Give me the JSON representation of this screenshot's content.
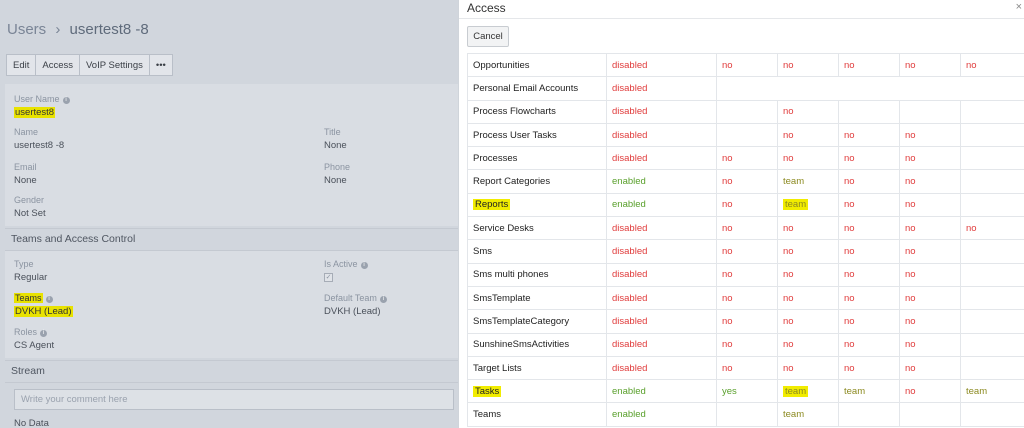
{
  "page": {
    "breadcrumb_root": "Users",
    "breadcrumb_sep": "›",
    "breadcrumb_user": "usertest8 -8"
  },
  "toolbar": {
    "edit_label": "Edit",
    "access_label": "Access",
    "voip_label": "VoIP Settings",
    "more_label": "•••"
  },
  "fields": {
    "user_name_label": "User Name",
    "user_name_value": "usertest8",
    "name_label": "Name",
    "name_value": "usertest8 -8",
    "title_label": "Title",
    "title_value": "None",
    "email_label": "Email",
    "email_value": "None",
    "phone_label": "Phone",
    "phone_value": "None",
    "gender_label": "Gender",
    "gender_value": "Not Set"
  },
  "teams_section": {
    "title": "Teams and Access Control",
    "type_label": "Type",
    "type_value": "Regular",
    "is_active_label": "Is Active",
    "is_active_checked": true,
    "teams_label": "Teams",
    "teams_value": "DVKH (Lead)",
    "default_team_label": "Default Team",
    "default_team_value": "DVKH (Lead)",
    "roles_label": "Roles",
    "roles_value": "CS Agent"
  },
  "stream": {
    "title": "Stream",
    "comment_placeholder": "Write your comment here",
    "empty_text": "No Data"
  },
  "modal": {
    "title": "Access",
    "close_glyph": "×",
    "cancel_label": "Cancel",
    "rows": [
      {
        "name": "Opportunities",
        "status": "disabled",
        "cells": [
          "no",
          "no",
          "no",
          "no",
          "no"
        ]
      },
      {
        "name": "Personal Email Accounts",
        "status": "disabled",
        "cells": []
      },
      {
        "name": "Process Flowcharts",
        "status": "disabled",
        "cells": [
          "",
          "no",
          "",
          "",
          ""
        ]
      },
      {
        "name": "Process User Tasks",
        "status": "disabled",
        "cells": [
          "",
          "no",
          "no",
          "no",
          ""
        ]
      },
      {
        "name": "Processes",
        "status": "disabled",
        "cells": [
          "no",
          "no",
          "no",
          "no",
          ""
        ]
      },
      {
        "name": "Report Categories",
        "status": "enabled",
        "cells": [
          "no",
          "team",
          "no",
          "no",
          ""
        ]
      },
      {
        "name": "Reports",
        "status": "enabled",
        "cells": [
          "no",
          "team",
          "no",
          "no",
          ""
        ],
        "highlight_name": true,
        "highlight_cell": 1
      },
      {
        "name": "Service Desks",
        "status": "disabled",
        "cells": [
          "no",
          "no",
          "no",
          "no",
          "no"
        ]
      },
      {
        "name": "Sms",
        "status": "disabled",
        "cells": [
          "no",
          "no",
          "no",
          "no",
          ""
        ]
      },
      {
        "name": "Sms multi phones",
        "status": "disabled",
        "cells": [
          "no",
          "no",
          "no",
          "no",
          ""
        ]
      },
      {
        "name": "SmsTemplate",
        "status": "disabled",
        "cells": [
          "no",
          "no",
          "no",
          "no",
          ""
        ]
      },
      {
        "name": "SmsTemplateCategory",
        "status": "disabled",
        "cells": [
          "no",
          "no",
          "no",
          "no",
          ""
        ]
      },
      {
        "name": "SunshineSmsActivities",
        "status": "disabled",
        "cells": [
          "no",
          "no",
          "no",
          "no",
          ""
        ]
      },
      {
        "name": "Target Lists",
        "status": "disabled",
        "cells": [
          "no",
          "no",
          "no",
          "no",
          ""
        ]
      },
      {
        "name": "Tasks",
        "status": "enabled",
        "cells": [
          "yes",
          "team",
          "team",
          "no",
          "team"
        ],
        "highlight_name": true,
        "highlight_cell": 1
      },
      {
        "name": "Teams",
        "status": "enabled",
        "cells": [
          "",
          "team",
          "",
          "",
          ""
        ]
      }
    ]
  },
  "colors": {
    "disabled": "#e03b3b",
    "enabled": "#5aa02c",
    "team": "#8c8a21",
    "highlight": "#f1ec00"
  }
}
